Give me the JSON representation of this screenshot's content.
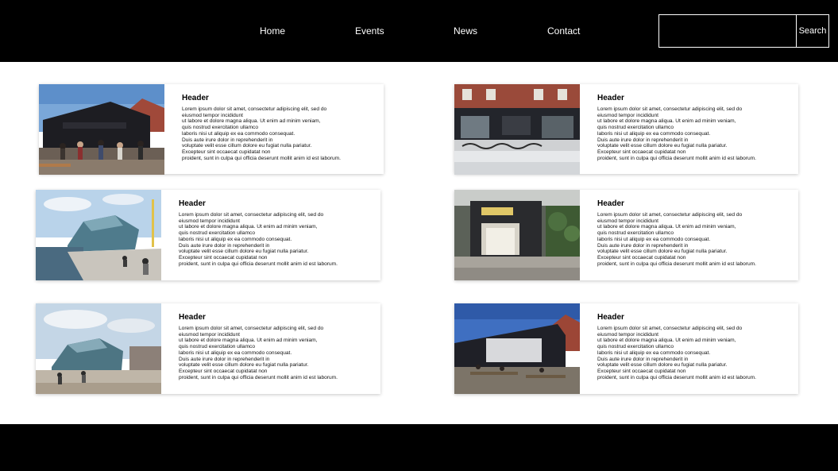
{
  "nav": {
    "links": [
      "Home",
      "Events",
      "News",
      "Contact"
    ],
    "search_placeholder": "",
    "search_button": "Search"
  },
  "card_text": {
    "header": "Header",
    "body_lines": [
      "Lorem ipsum dolor sit amet, consectetur adipiscing elit, sed do",
      "eiusmod tempor incididunt",
      "ut labore et dolore magna aliqua. Ut enim ad minim veniam,",
      "quis nostrud exercitation ullamco",
      "laboris nisi ut aliquip ex ea commodo consequat.",
      "Duis aute irure dolor in reprehenderit in",
      "voluptate velit esse cillum dolore eu fugiat nulla pariatur.",
      "Excepteur sint occaecat cupidatat non",
      "proident, sunt in culpa qui officia deserunt mollit anim id est laborum."
    ]
  },
  "cards": [
    {
      "image": "event-crowd-photo"
    },
    {
      "image": "building-facade-photo"
    },
    {
      "image": "harbor-building-photo"
    },
    {
      "image": "venue-entrance-photo"
    },
    {
      "image": "modern-building-plaza-photo"
    },
    {
      "image": "outdoor-terrace-photo"
    }
  ]
}
